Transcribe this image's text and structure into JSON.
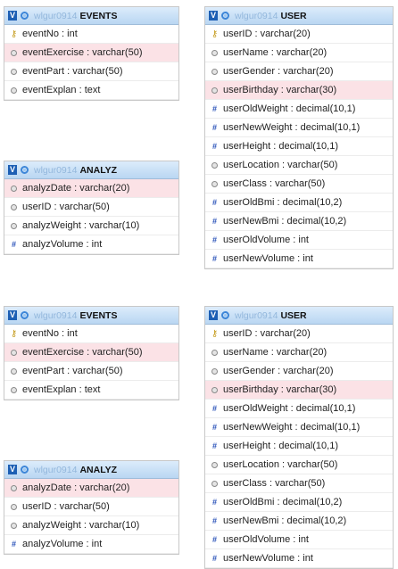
{
  "db_name": "wlgur0914",
  "diagrams": [
    {
      "events": {
        "name": "EVENTS",
        "fields": [
          {
            "label": "eventNo : int",
            "icon": "key"
          },
          {
            "label": "eventExercise : varchar(50)",
            "icon": "circle",
            "highlight": true
          },
          {
            "label": "eventPart : varchar(50)",
            "icon": "circle"
          },
          {
            "label": "eventExplan : text",
            "icon": "circle"
          }
        ]
      },
      "analyz": {
        "name": "ANALYZ",
        "fields": [
          {
            "label": "analyzDate : varchar(20)",
            "icon": "circle",
            "highlight": true
          },
          {
            "label": "userID : varchar(50)",
            "icon": "circle"
          },
          {
            "label": "analyzWeight : varchar(10)",
            "icon": "circle"
          },
          {
            "label": "analyzVolume : int",
            "icon": "hash"
          }
        ]
      },
      "user": {
        "name": "USER",
        "fields": [
          {
            "label": "userID : varchar(20)",
            "icon": "key"
          },
          {
            "label": "userName : varchar(20)",
            "icon": "circle"
          },
          {
            "label": "userGender : varchar(20)",
            "icon": "circle"
          },
          {
            "label": "userBirthday : varchar(30)",
            "icon": "circle",
            "highlight": true
          },
          {
            "label": "userOldWeight : decimal(10,1)",
            "icon": "hash"
          },
          {
            "label": "userNewWeight : decimal(10,1)",
            "icon": "hash"
          },
          {
            "label": "userHeight : decimal(10,1)",
            "icon": "hash"
          },
          {
            "label": "userLocation : varchar(50)",
            "icon": "circle"
          },
          {
            "label": "userClass : varchar(50)",
            "icon": "circle"
          },
          {
            "label": "userOldBmi : decimal(10,2)",
            "icon": "hash"
          },
          {
            "label": "userNewBmi : decimal(10,2)",
            "icon": "hash"
          },
          {
            "label": "userOldVolume : int",
            "icon": "hash"
          },
          {
            "label": "userNewVolume : int",
            "icon": "hash"
          }
        ]
      }
    },
    {
      "events": {
        "name": "EVENTS",
        "fields": [
          {
            "label": "eventNo : int",
            "icon": "key"
          },
          {
            "label": "eventExercise : varchar(50)",
            "icon": "circle",
            "highlight": true
          },
          {
            "label": "eventPart : varchar(50)",
            "icon": "circle"
          },
          {
            "label": "eventExplan : text",
            "icon": "circle"
          }
        ]
      },
      "analyz": {
        "name": "ANALYZ",
        "fields": [
          {
            "label": "analyzDate : varchar(20)",
            "icon": "circle",
            "highlight": true
          },
          {
            "label": "userID : varchar(50)",
            "icon": "circle"
          },
          {
            "label": "analyzWeight : varchar(10)",
            "icon": "circle"
          },
          {
            "label": "analyzVolume : int",
            "icon": "hash"
          }
        ]
      },
      "user": {
        "name": "USER",
        "fields": [
          {
            "label": "userID : varchar(20)",
            "icon": "key"
          },
          {
            "label": "userName : varchar(20)",
            "icon": "circle"
          },
          {
            "label": "userGender : varchar(20)",
            "icon": "circle"
          },
          {
            "label": "userBirthday : varchar(30)",
            "icon": "circle",
            "highlight": true
          },
          {
            "label": "userOldWeight : decimal(10,1)",
            "icon": "hash"
          },
          {
            "label": "userNewWeight : decimal(10,1)",
            "icon": "hash"
          },
          {
            "label": "userHeight : decimal(10,1)",
            "icon": "hash"
          },
          {
            "label": "userLocation : varchar(50)",
            "icon": "circle"
          },
          {
            "label": "userClass : varchar(50)",
            "icon": "circle"
          },
          {
            "label": "userOldBmi : decimal(10,2)",
            "icon": "hash"
          },
          {
            "label": "userNewBmi : decimal(10,2)",
            "icon": "hash"
          },
          {
            "label": "userOldVolume : int",
            "icon": "hash"
          },
          {
            "label": "userNewVolume : int",
            "icon": "hash"
          }
        ]
      }
    }
  ]
}
